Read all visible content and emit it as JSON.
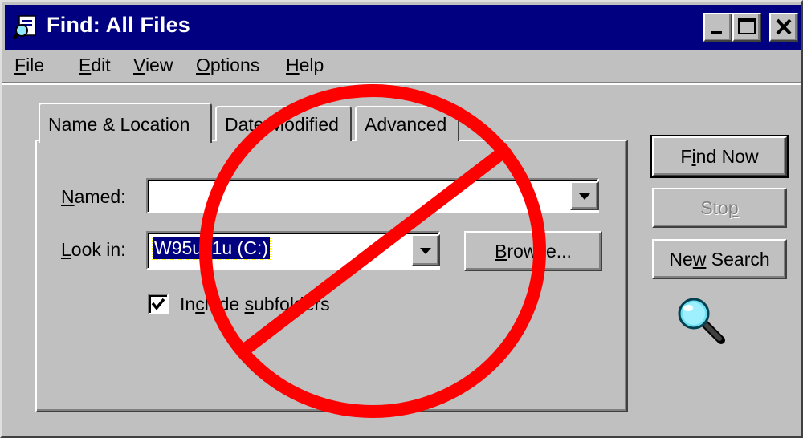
{
  "window": {
    "title": "Find: All Files",
    "title_icon": "find-files-icon",
    "controls": [
      "minimize-icon",
      "maximize-icon",
      "close-icon"
    ]
  },
  "menu": {
    "file": {
      "mnemonic": "F",
      "rest": "ile"
    },
    "edit": {
      "mnemonic": "E",
      "rest": "dit"
    },
    "view": {
      "mnemonic": "V",
      "rest": "iew"
    },
    "options": {
      "mnemonic": "O",
      "rest": "ptions"
    },
    "help": {
      "mnemonic": "H",
      "rest": "elp"
    }
  },
  "tabs": {
    "active": "Name & Location",
    "date_modified": "Date Modified",
    "advanced": "Advanced"
  },
  "form": {
    "named_label": {
      "mnemonic": "N",
      "rest": "amed:"
    },
    "named_value": "",
    "lookin_label": {
      "mnemonic": "L",
      "rest": "ook in:"
    },
    "lookin_value": "W95us1u (C:)",
    "browse_button": {
      "before": "",
      "mnemonic": "B",
      "rest": "rowse..."
    },
    "include_subfolders": {
      "before": "In",
      "mnemonic": "c",
      "rest": "lude ",
      "sub_mnemonic": "s",
      "sub_rest": "ubfolders"
    },
    "include_subfolders_checked": true
  },
  "actions": {
    "find_now": {
      "before": "F",
      "mnemonic": "i",
      "rest": "nd Now"
    },
    "stop": {
      "before": "Sto",
      "mnemonic": "p",
      "rest": ""
    },
    "new_search": {
      "before": "Ne",
      "mnemonic": "w",
      "rest": " Search"
    }
  },
  "overlay": {
    "symbol": "prohibition-sign",
    "color": "#ff0000"
  },
  "colors": {
    "titlebar": "#000080",
    "face": "#c0c0c0",
    "selection": "#000080"
  },
  "icons": {
    "search": "magnifier-icon"
  }
}
